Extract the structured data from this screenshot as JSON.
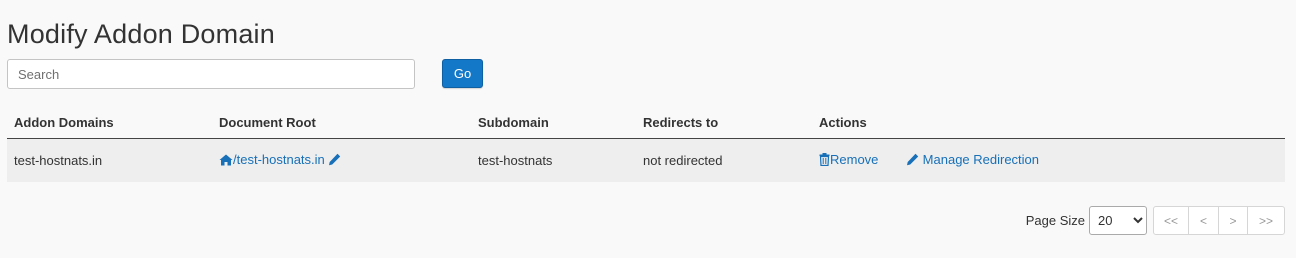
{
  "header": {
    "title": "Modify Addon Domain"
  },
  "search": {
    "placeholder": "Search",
    "go_label": "Go"
  },
  "table": {
    "columns": [
      "Addon Domains",
      "Document Root",
      "Subdomain",
      "Redirects to",
      "Actions"
    ],
    "rows": [
      {
        "domain": "test-hostnats.in",
        "document_root": "/test-hostnats.in",
        "subdomain": "test-hostnats",
        "redirects_to": "not redirected",
        "actions": [
          "Remove",
          "Manage Redirection"
        ]
      }
    ]
  },
  "pagination": {
    "page_size_label": "Page Size",
    "page_size": "20",
    "buttons": [
      "<<",
      "<",
      ">",
      ">>"
    ]
  },
  "colors": {
    "link": "#1770b8",
    "primary_button": "#1478c8",
    "row_background": "#eeeeee"
  },
  "icons": {
    "document_root": "home-icon",
    "edit": "pencil-icon",
    "remove": "trash-icon",
    "manage_redirection": "pencil-icon"
  }
}
